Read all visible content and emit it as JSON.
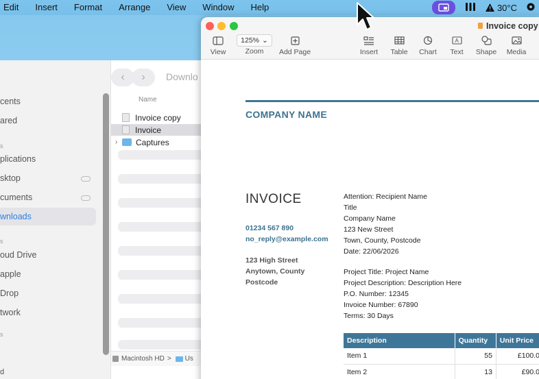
{
  "menubar": {
    "items": [
      "Edit",
      "Insert",
      "Format",
      "Arrange",
      "View",
      "Window",
      "Help"
    ],
    "temperature": "30°C"
  },
  "finder": {
    "title": "Downlo",
    "column_header": "Name",
    "sidebar": {
      "items": [
        {
          "label": "cents",
          "top": 0
        },
        {
          "label": "ared"
        },
        {
          "label": "plications"
        },
        {
          "label": "sktop"
        },
        {
          "label": "cuments"
        },
        {
          "label": "wnloads"
        },
        {
          "label": "oud Drive"
        },
        {
          "label": "apple"
        },
        {
          "label": "Drop"
        },
        {
          "label": "twork"
        }
      ],
      "selected": "wnloads"
    },
    "files": [
      "Invoice copy",
      "Invoice",
      "Captures"
    ],
    "selected_file": "Invoice",
    "path": {
      "disk": "Macintosh HD",
      "sep": ">",
      "next": "Us"
    }
  },
  "pages": {
    "doc_title": "Invoice copy",
    "toolbar": {
      "view": "View",
      "zoom_value": "125%",
      "zoom": "Zoom",
      "add_page": "Add Page",
      "insert": "Insert",
      "table": "Table",
      "chart": "Chart",
      "text": "Text",
      "shape": "Shape",
      "media": "Media"
    },
    "invoice": {
      "company": "COMPANY NAME",
      "title": "INVOICE",
      "phone": "01234 567 890",
      "email": "no_reply@example.com",
      "address": [
        "123 High Street",
        "Anytown, County",
        "Postcode"
      ],
      "recipient": [
        "Attention: Recipient Name",
        "Title",
        "Company Name",
        "123 New Street",
        "Town, County, Postcode",
        "Date: 22/06/2026"
      ],
      "project": [
        "Project Title: Project Name",
        "Project Description: Description Here",
        "P.O. Number: 12345",
        "Invoice Number: 67890",
        "Terms: 30 Days"
      ],
      "table": {
        "headers": [
          "Description",
          "Quantity",
          "Unit Price"
        ],
        "rows": [
          [
            "Item 1",
            "55",
            "£100.0"
          ],
          [
            "Item 2",
            "13",
            "£90.0"
          ]
        ]
      }
    }
  }
}
